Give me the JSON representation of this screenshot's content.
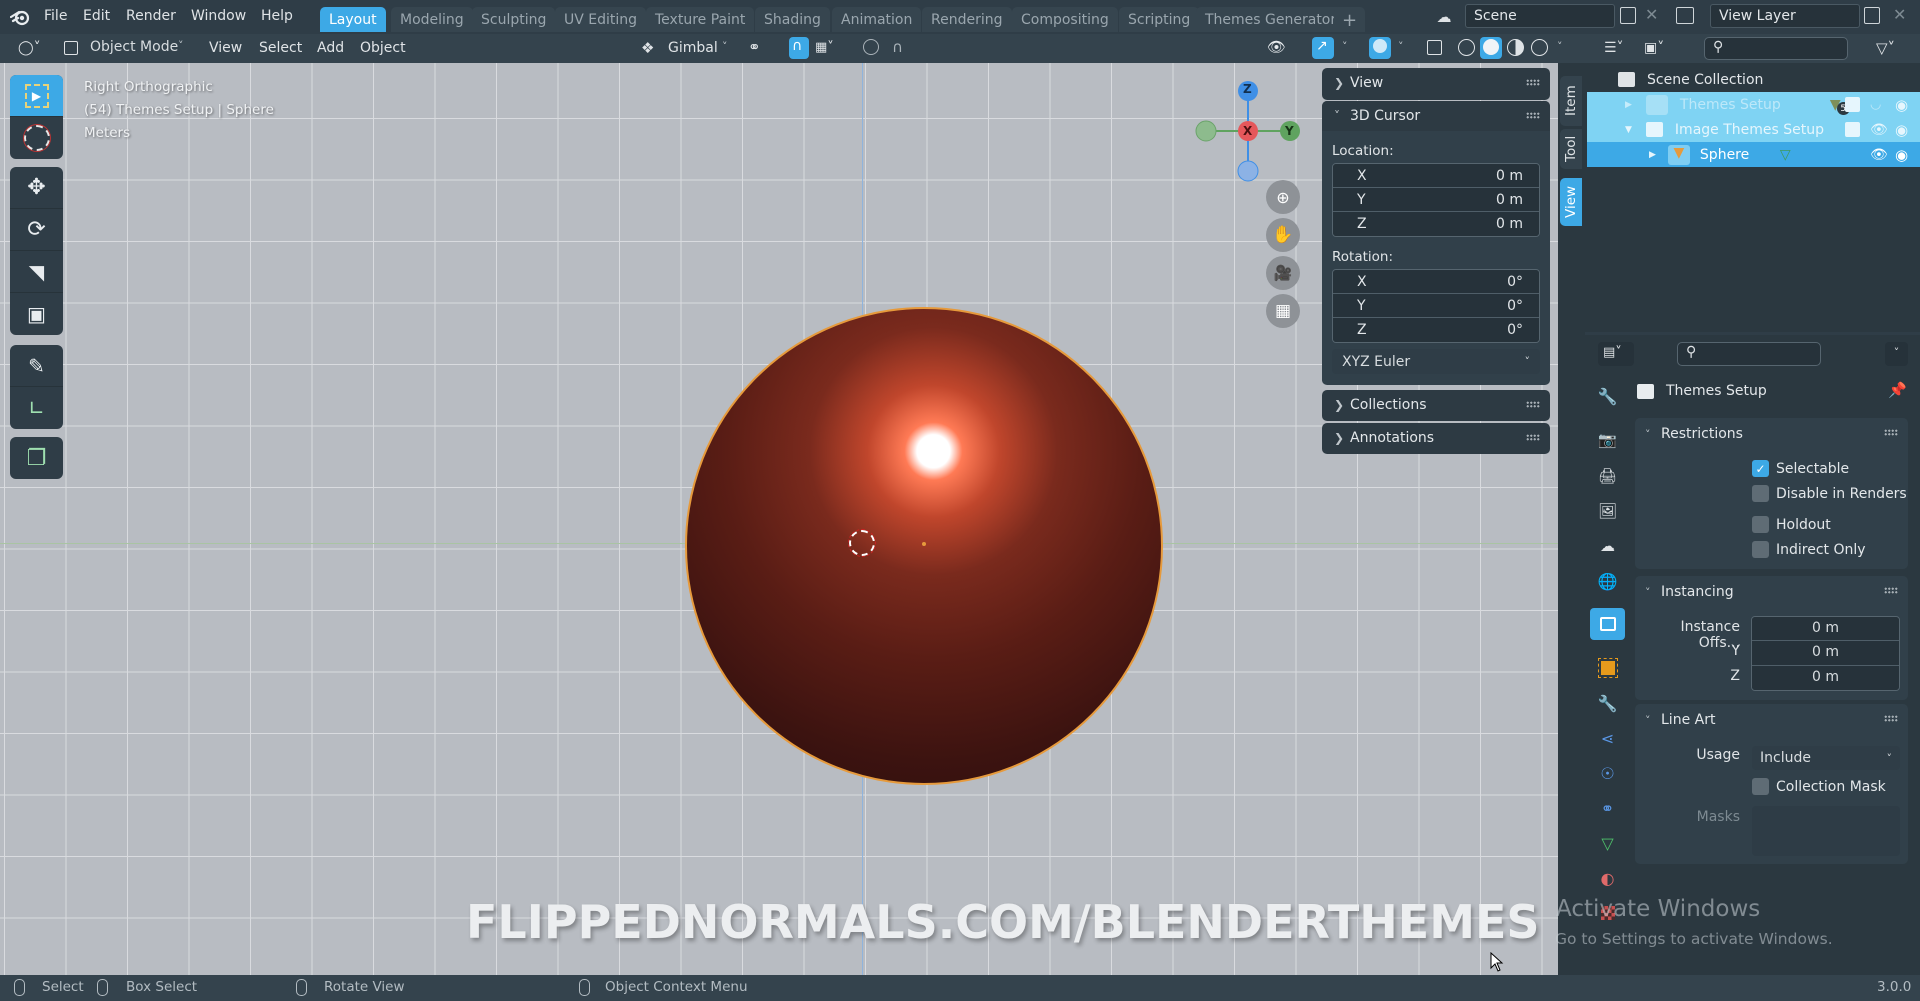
{
  "topbar": {
    "menus": [
      "File",
      "Edit",
      "Render",
      "Window",
      "Help"
    ],
    "workspaces": [
      "Layout",
      "Modeling",
      "Sculpting",
      "UV Editing",
      "Texture Paint",
      "Shading",
      "Animation",
      "Rendering",
      "Compositing",
      "Scripting",
      "Themes Generator"
    ],
    "active_workspace": "Layout",
    "add_workspace": "+",
    "scene": "Scene",
    "view_layer": "View Layer"
  },
  "header": {
    "mode": "Object Mode",
    "menus": [
      "View",
      "Select",
      "Add",
      "Object"
    ],
    "orientation": "Gimbal"
  },
  "viewport": {
    "overlay_lines": [
      "Right Orthographic",
      "(54) Themes Setup | Sphere",
      "Meters"
    ],
    "gizmo_axes": {
      "z": "Z",
      "x": "X",
      "y": "Y"
    },
    "watermark": "FLIPPEDNORMALS.COM/BLENDERTHEMES",
    "activate_title": "Activate Windows",
    "activate_sub": "Go to Settings to activate Windows."
  },
  "npanel": {
    "tabs": [
      "Item",
      "Tool",
      "View"
    ],
    "active_tab": "View",
    "view_panel": "View",
    "cursor_panel": "3D Cursor",
    "location_label": "Location:",
    "location": [
      {
        "axis": "X",
        "value": "0 m"
      },
      {
        "axis": "Y",
        "value": "0 m"
      },
      {
        "axis": "Z",
        "value": "0 m"
      }
    ],
    "rotation_label": "Rotation:",
    "rotation": [
      {
        "axis": "X",
        "value": "0°"
      },
      {
        "axis": "Y",
        "value": "0°"
      },
      {
        "axis": "Z",
        "value": "0°"
      }
    ],
    "rotation_mode": "XYZ Euler",
    "collections_panel": "Collections",
    "annotations_panel": "Annotations"
  },
  "outliner": {
    "root": "Scene Collection",
    "rows": [
      {
        "name": "Themes Setup",
        "badge": "5"
      },
      {
        "name": "Image Themes Setup"
      },
      {
        "name": "Sphere"
      }
    ]
  },
  "properties": {
    "context_title": "Themes Setup",
    "restrictions": {
      "title": "Restrictions",
      "selectable": {
        "label": "Selectable",
        "checked": true
      },
      "disable_in_renders": {
        "label": "Disable in Renders",
        "checked": false
      },
      "holdout": {
        "label": "Holdout",
        "checked": false
      },
      "indirect_only": {
        "label": "Indirect Only",
        "checked": false
      }
    },
    "instancing": {
      "title": "Instancing",
      "offset_label": "Instance Offs...",
      "x": "0 m",
      "y_label": "Y",
      "y": "0 m",
      "z_label": "Z",
      "z": "0 m"
    },
    "line_art": {
      "title": "Line Art",
      "usage_label": "Usage",
      "usage": "Include",
      "collection_mask": {
        "label": "Collection Mask",
        "checked": false
      },
      "masks_label": "Masks"
    }
  },
  "status": {
    "select": "Select",
    "box_select": "Box Select",
    "rotate_view": "Rotate View",
    "context_menu": "Object Context Menu",
    "version": "3.0.0"
  },
  "colors": {
    "accent": "#3da9e6",
    "viewport_bg": "#b8bcc2",
    "panel_bg": "#2f3d47",
    "selection_highlight": "#7fd3f3",
    "axis_x": "#e5575b",
    "axis_y": "#5fa35f",
    "axis_z": "#3f8fe6"
  }
}
